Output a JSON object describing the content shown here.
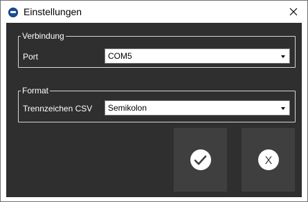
{
  "window": {
    "title": "Einstellungen",
    "close_glyph": "✕"
  },
  "connection": {
    "legend": "Verbindung",
    "port_label": "Port",
    "port_value": "COM5"
  },
  "format": {
    "legend": "Format",
    "separator_label": "Trennzeichen CSV",
    "separator_value": "Semikolon"
  },
  "buttons": {
    "confirm_icon": "checkmark-icon",
    "cancel_icon": "x-icon",
    "cancel_glyph": "X"
  },
  "colors": {
    "panel_bg": "#2f2f2f",
    "button_bg": "#3f3f3f",
    "icon_circle": "#ffffff"
  }
}
